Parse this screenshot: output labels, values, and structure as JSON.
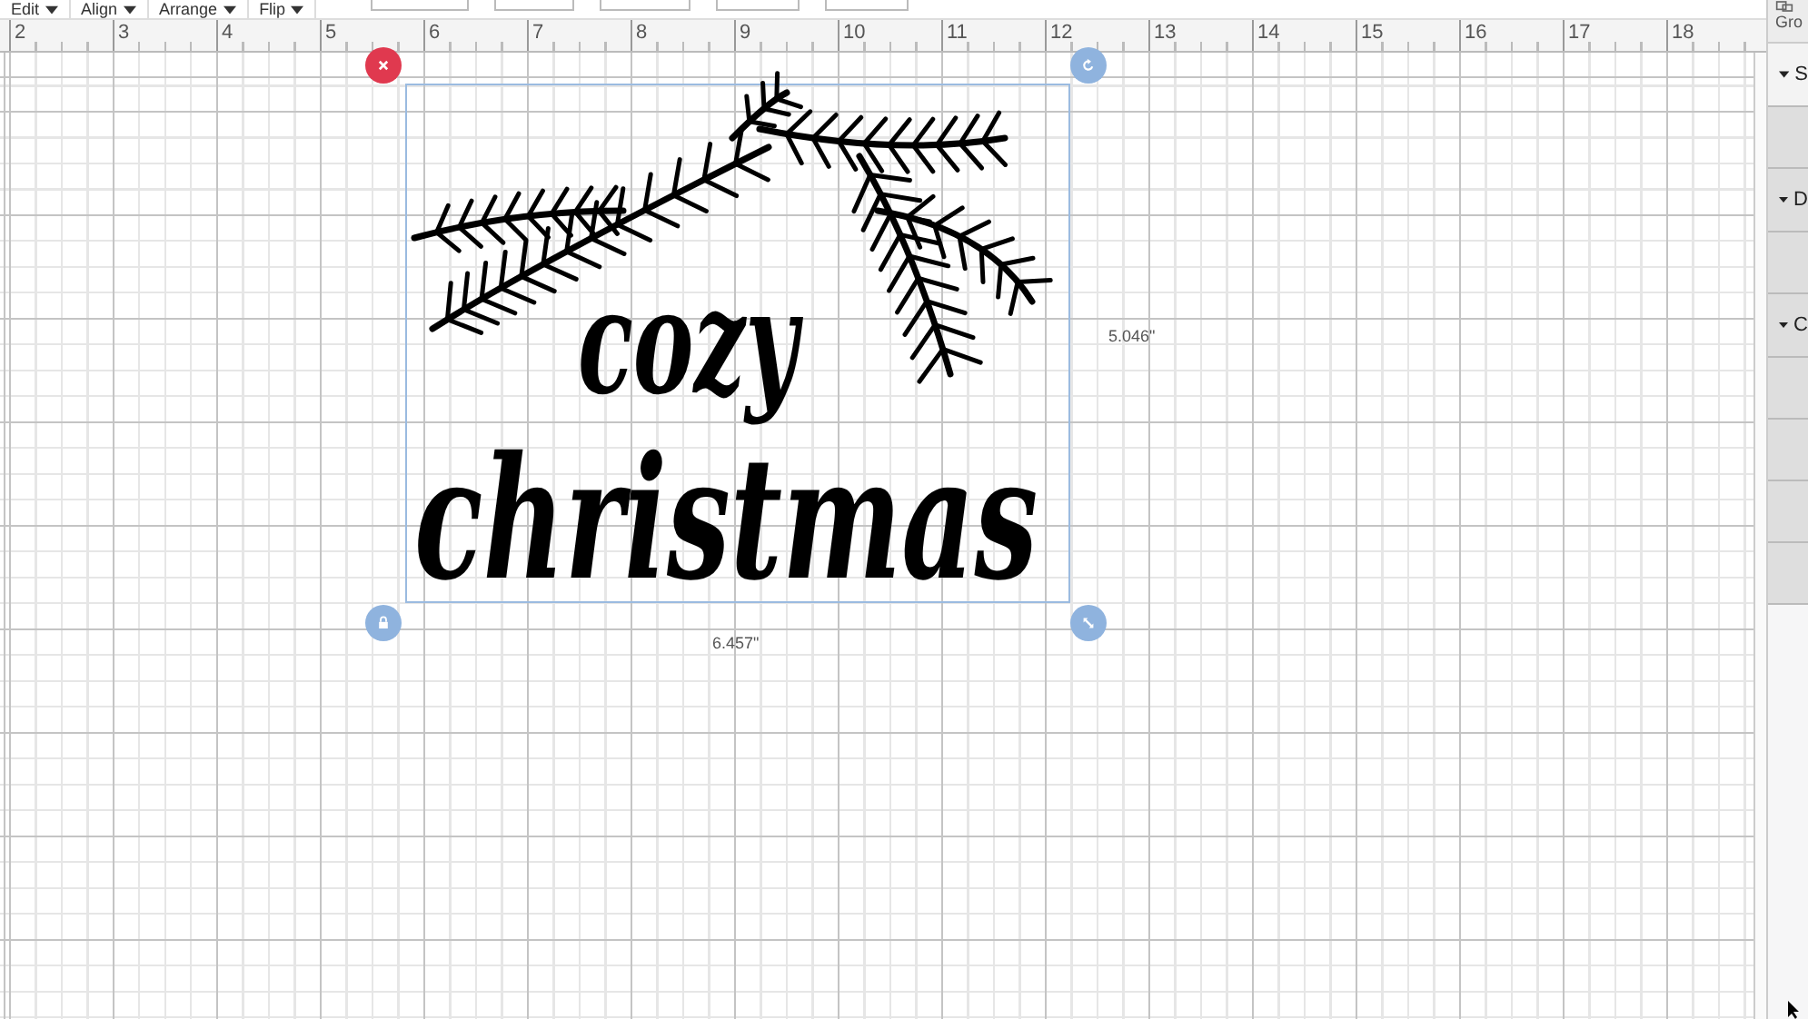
{
  "toolbar": {
    "menus": [
      {
        "label": "Edit"
      },
      {
        "label": "Align"
      },
      {
        "label": "Arrange"
      },
      {
        "label": "Flip"
      }
    ]
  },
  "ruler": {
    "marks": [
      "2",
      "3",
      "4",
      "5",
      "6",
      "7",
      "8",
      "9",
      "10",
      "11",
      "12",
      "13",
      "14",
      "15",
      "16",
      "17",
      "18"
    ]
  },
  "canvas": {
    "artwork": {
      "lines": [
        "cozy",
        "christmas"
      ]
    },
    "selection": {
      "height": "5.046\"",
      "width": "6.457\""
    }
  },
  "panel": {
    "top_button": "Gro",
    "sections": [
      {
        "label": "S",
        "expanded": true
      },
      {
        "label": "D",
        "expanded": true
      },
      {
        "label": "C",
        "expanded": true
      }
    ]
  }
}
